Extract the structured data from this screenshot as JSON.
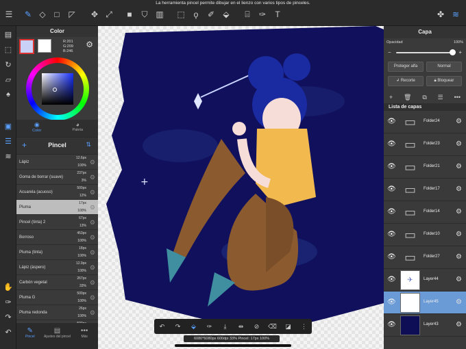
{
  "hint_text": "La herramienta pincel permite dibujar en el lienzo con varios tipos de pinceles.",
  "color_panel": {
    "title": "Color",
    "rgb_r": "R:201",
    "rgb_g": "G:209",
    "rgb_b": "B:246",
    "primary_color": "#c9d1f6",
    "tab_color": "Color",
    "tab_palette": "Paleta"
  },
  "brush_panel": {
    "title": "Pincel",
    "items": [
      {
        "name": "Lápiz",
        "size": "12.6px",
        "opacity": "100%"
      },
      {
        "name": "Goma de borrar (suave)",
        "size": "237px",
        "opacity": "3%"
      },
      {
        "name": "Acuarela (acuoso)",
        "size": "500px",
        "opacity": "12%"
      },
      {
        "name": "Pluma",
        "size": "17px",
        "opacity": "100%"
      },
      {
        "name": "Pincel (tinta) 2",
        "size": "67px",
        "opacity": "13%"
      },
      {
        "name": "Borroso",
        "size": "453px",
        "opacity": "100%"
      },
      {
        "name": "Pluma (tinta)",
        "size": "18px",
        "opacity": "100%"
      },
      {
        "name": "Lápiz (áspero)",
        "size": "12.9px",
        "opacity": "100%"
      },
      {
        "name": "Carbón vegetal",
        "size": "267px",
        "opacity": "33%"
      },
      {
        "name": "Pluma G",
        "size": "500px",
        "opacity": "100%"
      },
      {
        "name": "Pluma redonda",
        "size": "26px",
        "opacity": "100%"
      },
      {
        "name": "",
        "size": "500px",
        "opacity": ""
      }
    ],
    "bottom_tabs": [
      "Pincel",
      "Ajustes del pincel",
      "Más"
    ]
  },
  "status_text": "6080*6080px 600dpi 33% Pincel: 17px 100%",
  "layer_panel": {
    "title": "Capa",
    "opacity_label": "Opacidad",
    "opacity_value": "100%",
    "opacity_level": 1.0,
    "protect_alpha": "Proteger alfa",
    "blend_mode": "Normal",
    "clip_label": "Recorte",
    "lock_label": "Bloquear",
    "list_header": "Lista de capas",
    "layers": [
      {
        "name": "Folder24",
        "type": "folder",
        "selected": false
      },
      {
        "name": "Folder23",
        "type": "folder",
        "selected": false
      },
      {
        "name": "Folder21",
        "type": "folder",
        "selected": false
      },
      {
        "name": "Folder17",
        "type": "folder",
        "selected": false
      },
      {
        "name": "Folder14",
        "type": "folder",
        "selected": false
      },
      {
        "name": "Folder10",
        "type": "folder",
        "selected": false
      },
      {
        "name": "Folder27",
        "type": "folder",
        "selected": false
      },
      {
        "name": "Layer44",
        "type": "sketch",
        "selected": false
      },
      {
        "name": "Layer45",
        "type": "blank",
        "selected": true
      },
      {
        "name": "Layer43",
        "type": "dark",
        "selected": false
      }
    ]
  },
  "colors": {
    "accent": "#5aa0ff",
    "selected_layer": "#6a9bd6",
    "night_sky": "#0f0f5a"
  }
}
